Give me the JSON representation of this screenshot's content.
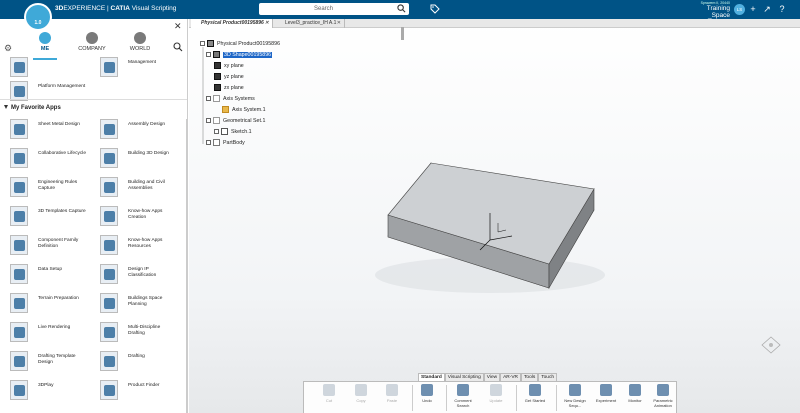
{
  "topbar": {
    "brand_prefix": "3D",
    "brand_experience": "EXPERIENCE",
    "brand_app": "CATIA",
    "brand_module": "Visual Scripting",
    "compass_version": "1.0",
    "search_placeholder": "Search",
    "user_line": "Sprawem II, 20440",
    "space": "Training _Space",
    "avatar_initials": "LS",
    "colors": {
      "bar": "#005386",
      "accent": "#3fa9d8"
    }
  },
  "leftpanel": {
    "tabs": [
      {
        "label": "ME"
      },
      {
        "label": "COMPANY"
      },
      {
        "label": "WORLD"
      }
    ],
    "top_apps": [
      {
        "label": ""
      },
      {
        "label": "Management"
      },
      {
        "label": "Platform Management"
      }
    ],
    "favorites_title": "My Favorite Apps",
    "apps": [
      {
        "label": "Sheet Metal Design"
      },
      {
        "label": "Assembly Design"
      },
      {
        "label": "Collaborative Lifecycle"
      },
      {
        "label": "Building 3D Design"
      },
      {
        "label": "Engineering Rules Capture"
      },
      {
        "label": "Building and Civil Assemblies"
      },
      {
        "label": "3D Templates Capture"
      },
      {
        "label": "Know-how Apps Creation"
      },
      {
        "label": "Component Family Definition"
      },
      {
        "label": "Know-how Apps Resources"
      },
      {
        "label": "Data Setup"
      },
      {
        "label": "Design IP Classification"
      },
      {
        "label": "Terrain Preparation"
      },
      {
        "label": "Buildings Space Planning"
      },
      {
        "label": "Live Rendering"
      },
      {
        "label": "Multi-Discipline Drafting"
      },
      {
        "label": "Drafting Template Design"
      },
      {
        "label": "Drafting"
      },
      {
        "label": "3DPlay"
      },
      {
        "label": "Product Finder"
      }
    ]
  },
  "doc_tabs": [
    {
      "label": "Physical Product00195896"
    },
    {
      "label": "Level3_practice_IH A.1"
    }
  ],
  "tree": {
    "root": "Physical Product00195896",
    "shape": "3D Shape00195896",
    "planes": [
      "xy plane",
      "yz plane",
      "zx plane"
    ],
    "axis_systems": "Axis Systems",
    "axis_system": "Axis System.1",
    "geo_set": "Geometrical Set.1",
    "sketch": "Sketch.1",
    "partbody": "PartBody"
  },
  "toolbar": {
    "tabs": [
      "Standard",
      "Visual Scripting",
      "View",
      "AR-VR",
      "Tools",
      "Touch"
    ],
    "buttons": [
      {
        "label": "Cut",
        "icon": "scissors-icon"
      },
      {
        "label": "Copy",
        "icon": "copy-icon"
      },
      {
        "label": "Paste",
        "icon": "paste-icon"
      },
      {
        "label": "Undo",
        "icon": "undo-icon"
      },
      {
        "label": "Comment Search",
        "icon": "search-icon"
      },
      {
        "label": "Update",
        "icon": "update-icon"
      },
      {
        "label": "Get Started",
        "icon": "help-icon"
      },
      {
        "label": "New Design Sequ...",
        "icon": "design-sequence-icon"
      },
      {
        "label": "Experiment",
        "icon": "experiment-icon"
      },
      {
        "label": "Monitor",
        "icon": "monitor-icon"
      },
      {
        "label": "Parametric Animation",
        "icon": "animation-icon"
      }
    ]
  }
}
